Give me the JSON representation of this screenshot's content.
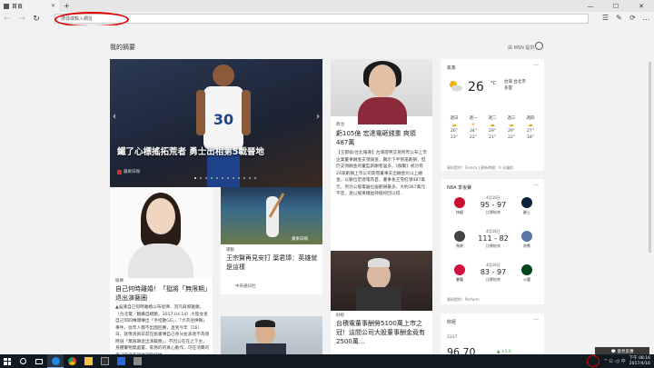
{
  "browser": {
    "tab_title": "首頁",
    "tab_close": "✕",
    "new_tab": "+",
    "window_controls": [
      "—",
      "☐",
      "✕"
    ],
    "nav": {
      "back": "←",
      "forward": "→",
      "refresh": "↻"
    },
    "address_placeholder": "搜尋或輸入網址",
    "tools": [
      "☰",
      "✎",
      "⟳",
      "…"
    ]
  },
  "feed": {
    "heading": "我的摘要",
    "msn_label": "由 MSN 提供",
    "hero": {
      "caption": "鐵了心標搖拓荒者 勇士出相第5戰晉地",
      "source": "蘋果日報",
      "dots_count": 12,
      "active_dot": 0
    },
    "story_b": {
      "label": "政治",
      "headline": "虧105億 宏達電砸錢重 爽領487萬",
      "body": "【王郁倫/台北報導】台灣證券交易所昨公布上市企業董事酬金支領調查，顯示下半營運虧損，但仍支領酬金的董監薪酬者居多。《群聚》統計有24家虧損上市公司高階董事支出酬金比以上酬金，以數位宏達電為首，董事長王雪紅領487萬元，另外公股電器位居虧損最多，大約367萬元不定，逐以股東權益持擔好回以得…"
    },
    "story_woman": {
      "label": "娛樂",
      "headline": "自己何時離婚！「挺將「無限期」退出演藝圈",
      "body": "▲吳蓮自己何時離婚公布從彈、羽凡與郭雅蘭，（台北電／翻攝自網路，2017.04.14）大陸女星自己何四傳爆傳出「手指動GG」、「大衣往揮舞」事件，從年人都不出面回應，直到今年（16）日，就像演員日前在臉書傳自己身分並表達不為情時說「無限期退出演藝圈」，不因公在在之下主，身體實物資處置、家務的的真心動作，可在消費的自己完全不同地說和好她…"
    },
    "story_baseball": {
      "label": "運動",
      "headline": "王宗賢再見安打 葉君璋：英雄就是這樣",
      "source": "中央通訊社",
      "image_source": "蘋果日報"
    },
    "story_tsmc": {
      "label": "財經",
      "headline": "台積電董事酬勞5100萬上市之冠！這間公司大股董事酬金竟有2500萬…"
    },
    "weather": {
      "title": "氣象",
      "temp": "26",
      "unit": "°C",
      "city_line1": "台灣 台北市",
      "city_line2": "多雲",
      "days": [
        {
          "day": "週日",
          "hi": "26°",
          "lo": "23°",
          "icon": "☁"
        },
        {
          "day": "週一",
          "hi": "34°",
          "lo": "22°",
          "icon": "☀"
        },
        {
          "day": "週二",
          "hi": "29°",
          "lo": "21°",
          "icon": "☁"
        },
        {
          "day": "週三",
          "hi": "29°",
          "lo": "22°",
          "icon": "☁"
        },
        {
          "day": "週四",
          "hi": "27°",
          "lo": "18°",
          "icon": "☁"
        }
      ],
      "source": "資料提供：Foreca | 更新時間：6 分鐘前"
    },
    "nba": {
      "title": "NBA 季後賽",
      "games": [
        {
          "date": "4月16日",
          "home": "快艇",
          "away": "爵士",
          "score": "95 - 97",
          "status": "比賽結束",
          "home_color": "#c8102e",
          "away_color": "#0c2340"
        },
        {
          "date": "4月16日",
          "home": "馬刺",
          "away": "灰熊",
          "score": "111 - 82",
          "status": "比賽結束",
          "home_color": "#444444",
          "away_color": "#5d76a9"
        },
        {
          "date": "4月16日",
          "home": "暴龍",
          "away": "公鹿",
          "score": "83 - 97",
          "status": "比賽結束",
          "home_color": "#ce1141",
          "away_color": "#00471b"
        }
      ],
      "source": "資料提供：Perform"
    },
    "stocks": {
      "title": "財經",
      "index_label": "2317",
      "value": "96.70",
      "change": "▲ +1.0"
    }
  },
  "feedback_button": "💬 意見反應",
  "taskbar": {
    "icons": [
      "search-icon",
      "taskview-icon",
      "edge-icon",
      "chrome-icon",
      "explorer-icon",
      "store-icon",
      "mail-icon",
      "photo-icon"
    ],
    "tray_text": "^ ⊡ ◁) 中",
    "time": "下午 08:16",
    "date": "2017/4/16"
  }
}
